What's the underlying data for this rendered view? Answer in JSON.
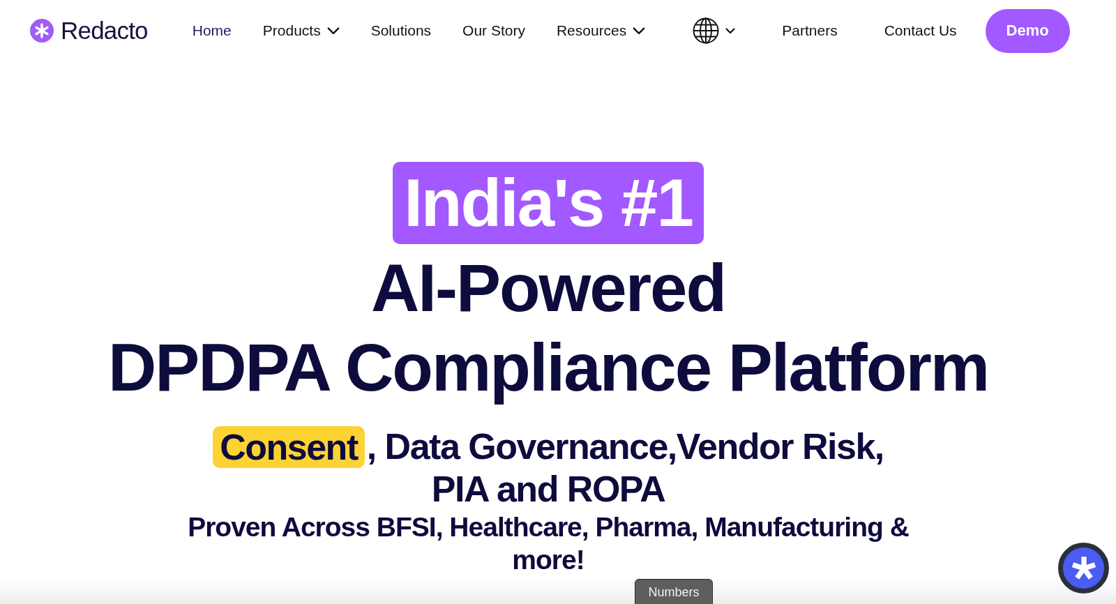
{
  "header": {
    "brand": "Redacto",
    "nav": [
      {
        "label": "Home",
        "kind": "link",
        "selected": true
      },
      {
        "label": "Products",
        "kind": "dropdown",
        "selected": false
      },
      {
        "label": "Solutions",
        "kind": "link",
        "selected": false
      },
      {
        "label": "Our Story",
        "kind": "link",
        "selected": false
      },
      {
        "label": "Resources",
        "kind": "dropdown",
        "selected": false
      }
    ],
    "secondary_nav": [
      {
        "label": "Partners",
        "selected": false
      },
      {
        "label": "Contact Us",
        "selected": false
      }
    ],
    "cta": "Demo"
  },
  "hero": {
    "badge": "India's #1",
    "title_lines": [
      "AI-Powered",
      "DPDPA Compliance Platform"
    ],
    "subtitle": {
      "highlight": "Consent",
      "lines": [
        ", Data Governance,Vendor Risk,",
        "PIA and ROPA"
      ]
    },
    "tagline": "Proven Across BFSI, Healthcare, Pharma, Manufacturing & more!"
  },
  "tooltip": "Numbers"
}
